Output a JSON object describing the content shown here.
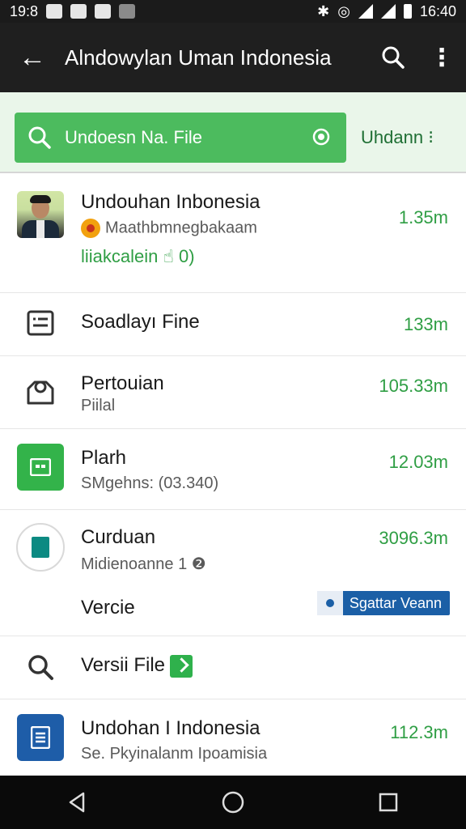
{
  "status_bar": {
    "time_left": "19:8",
    "time_right": "16:40"
  },
  "app_bar": {
    "back_icon": "arrow-left-icon",
    "title": "Alndowylan Uman Indonesia",
    "search_icon": "search-icon",
    "more_icon": "more-vert-icon"
  },
  "search": {
    "placeholder": "Undoesn Na. File",
    "side_action": "Uhdann ⁝"
  },
  "list": [
    {
      "title": "Undouhan Inbonesia",
      "subtitle": "Maathbmnegbakaam",
      "tag": "liiakcalein ☝ 0)",
      "size": "1.35m"
    },
    {
      "title": "Soadlayı Fine",
      "size": "133m"
    },
    {
      "title": "Pertouian",
      "subtitle": "Piilal",
      "size": "105.33m"
    },
    {
      "title": "Plarh",
      "subtitle": "SMgehns: (03.340)",
      "size": "12.03m"
    },
    {
      "title": "Curduan",
      "subtitle": "Midienoanne 1",
      "subtitle_badge": "❷",
      "size": "3096.3m"
    },
    {
      "title": "Vercie",
      "pill": "Sgattar Veann"
    },
    {
      "title": "Versii File"
    },
    {
      "title": "Undohan I Indonesia",
      "subtitle": "Se. Pkyinalanm Ipoamisia",
      "size": "112.3m"
    }
  ],
  "colors": {
    "app_bar": "#1f1f1f",
    "accent_green": "#4cbb5e",
    "size_green": "#2f9e44",
    "pill_blue": "#1b5fa6"
  }
}
